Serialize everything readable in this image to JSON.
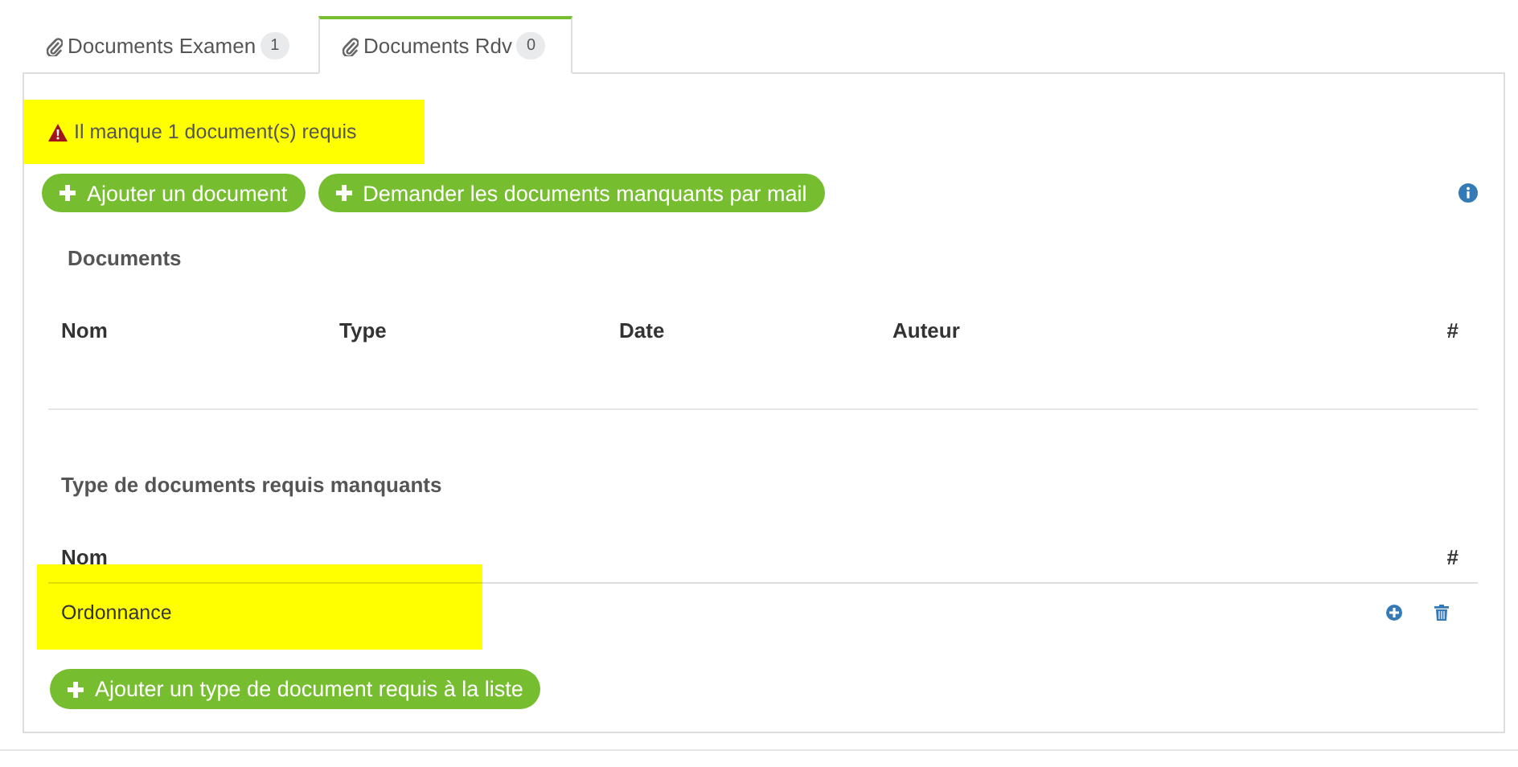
{
  "tabs": [
    {
      "label": "Documents Examen",
      "count": "1",
      "selected": false
    },
    {
      "label": "Documents Rdv",
      "count": "0",
      "selected": true
    }
  ],
  "alert": {
    "text": "Il manque 1 document(s) requis",
    "highlighted": true
  },
  "actions": [
    "Ajouter un document",
    "Demander les documents manquants par mail"
  ],
  "documents": {
    "title": "Documents",
    "columns": [
      "Nom",
      "Type",
      "Date",
      "Auteur",
      "#"
    ]
  },
  "missing": {
    "title": "Type de documents requis manquants",
    "columns": [
      "Nom",
      "#"
    ],
    "rows": [
      {
        "name": "Ordonnance",
        "highlighted": true
      }
    ],
    "add_button": "Ajouter un type de document requis à la liste"
  }
}
